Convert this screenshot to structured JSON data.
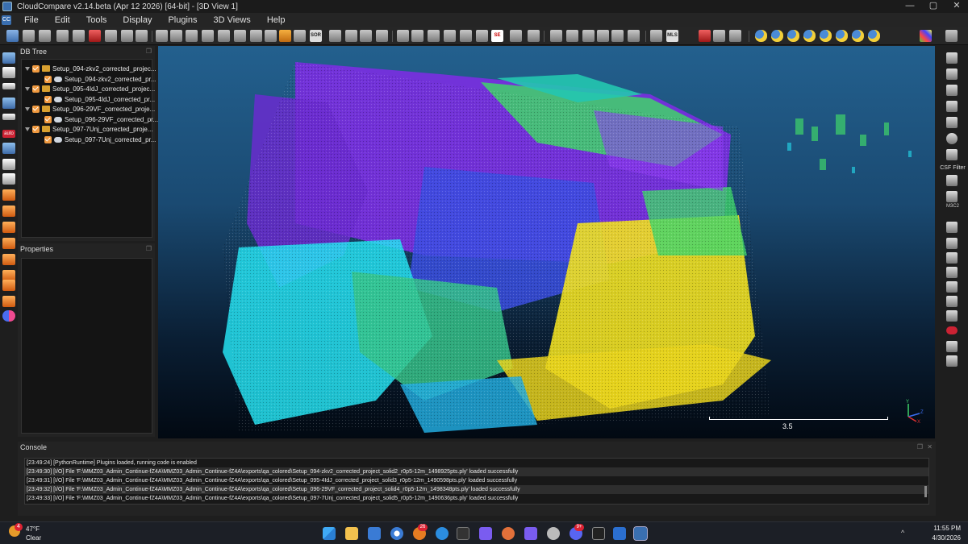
{
  "window": {
    "title": "CloudCompare v2.14.beta (Apr 12 2026) [64-bit] - [3D View 1]",
    "minimize": "—",
    "maximize": "▢",
    "close": "✕"
  },
  "menu": [
    "File",
    "Edit",
    "Tools",
    "Display",
    "Plugins",
    "3D Views",
    "Help"
  ],
  "mdi_controls": {
    "minimize": "—",
    "restore": "❐",
    "close": "✕"
  },
  "toolbar_text_icons": {
    "sor": "SOR",
    "mls": "MLS",
    "se": "SE"
  },
  "left_toolbar_text": {
    "auto": "auto"
  },
  "db_tree": {
    "title": "DB Tree",
    "nodes": [
      {
        "label": "Setup_094-zkv2_corrected_projec...",
        "type": "folder"
      },
      {
        "label": "Setup_094-zkv2_corrected_pr...",
        "type": "cloud"
      },
      {
        "label": "Setup_095-4IdJ_corrected_projec...",
        "type": "folder"
      },
      {
        "label": "Setup_095-4IdJ_corrected_pr...",
        "type": "cloud"
      },
      {
        "label": "Setup_096-29VF_corrected_proje...",
        "type": "folder"
      },
      {
        "label": "Setup_096-29VF_corrected_pr...",
        "type": "cloud"
      },
      {
        "label": "Setup_097-7Unj_corrected_proje...",
        "type": "folder"
      },
      {
        "label": "Setup_097-7Unj_corrected_pr...",
        "type": "cloud"
      }
    ]
  },
  "properties": {
    "title": "Properties"
  },
  "view3d": {
    "scale_label": "3.5",
    "axis_labels": {
      "x": "X",
      "y": "Y",
      "z": "Z"
    },
    "colors": {
      "purple": "#7a2fe0",
      "blue": "#3a4de0",
      "teal": "#24c6b0",
      "green": "#3fd46a",
      "cyan": "#25e0f0",
      "yellow": "#f0e020"
    }
  },
  "right_toolbar": {
    "csf_label": "CSF Filter",
    "m3c2_label": "M3C2"
  },
  "console": {
    "title": "Console",
    "lines": [
      "[23:49:24] [PythonRuntime] Plugins loaded, running code is enabled",
      "[23:49:30] [I/O] File 'F:\\MMZ03_Admin_Continue-fZ4A\\MMZ03_Admin_Continue-fZ4A\\exports\\qa_colored\\Setup_094-zkv2_corrected_project_solid2_r0p5-12m_1498925pts.ply' loaded successfully",
      "[23:49:31] [I/O] File 'F:\\MMZ03_Admin_Continue-fZ4A\\MMZ03_Admin_Continue-fZ4A\\exports\\qa_colored\\Setup_095-4IdJ_corrected_project_solid3_r0p5-12m_1490598pts.ply' loaded successfully",
      "[23:49:32] [I/O] File 'F:\\MMZ03_Admin_Continue-fZ4A\\MMZ03_Admin_Continue-fZ4A\\exports\\qa_colored\\Setup_096-29VF_corrected_project_solid4_r0p5-12m_1498348pts.ply' loaded successfully",
      "[23:49:33] [I/O] File 'F:\\MMZ03_Admin_Continue-fZ4A\\MMZ03_Admin_Continue-fZ4A\\exports\\qa_colored\\Setup_097-7Unj_corrected_project_solid5_r0p5-12m_1490636pts.ply' loaded successfully"
    ]
  },
  "taskbar": {
    "weather": {
      "temp": "47°F",
      "condition": "Clear",
      "badge": "4"
    },
    "badges": {
      "browser": "26",
      "discord": "9+"
    },
    "chevron": "^",
    "time": "11:55 PM",
    "date": "4/30/2026"
  }
}
